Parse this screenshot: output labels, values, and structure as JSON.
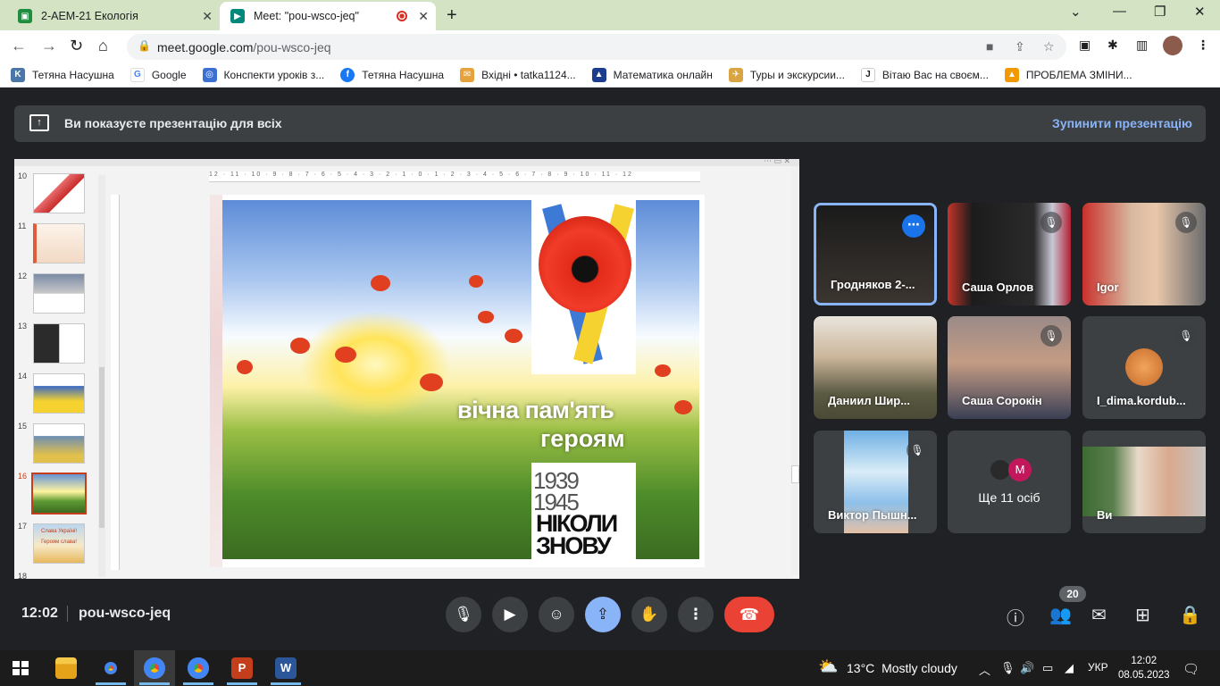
{
  "browser": {
    "tabs": [
      {
        "title": "2-АЕМ-21 Екологія",
        "favicon": "classroom-icon"
      },
      {
        "title": "Meet: \"pou-wsco-jeq\"",
        "favicon": "meet-icon",
        "recording": true
      }
    ],
    "url_host": "meet.google.com",
    "url_path": "/pou-wsco-jeq",
    "bookmarks": [
      {
        "label": "Тетяна Насушна",
        "icon": "vk-icon",
        "color": "#4a76a8"
      },
      {
        "label": "Google",
        "icon": "google-icon",
        "color": "#4285f4"
      },
      {
        "label": "Конспекти уроків з...",
        "icon": "globe-icon",
        "color": "#3b6fd1"
      },
      {
        "label": "Тетяна Насушна",
        "icon": "facebook-icon",
        "color": "#1877f2"
      },
      {
        "label": "Вхідні • tatka1124...",
        "icon": "mail-icon",
        "color": "#e6a23c"
      },
      {
        "label": "Математика онлайн",
        "icon": "triangle-icon",
        "color": "#1a3d8f"
      },
      {
        "label": "Туры и экскурсии...",
        "icon": "tour-icon",
        "color": "#d9a441"
      },
      {
        "label": "Вітаю Вас на своєм...",
        "icon": "j-icon",
        "color": "#222222"
      },
      {
        "label": "ПРОБЛЕМА ЗМІНИ...",
        "icon": "flame-icon",
        "color": "#f29900"
      }
    ]
  },
  "meet": {
    "banner_text": "Ви показуєте презентацію для всіх",
    "stop_label": "Зупинити презентацію",
    "time": "12:02",
    "meeting_code": "pou-wsco-jeq",
    "participant_count": "20",
    "participants": [
      {
        "name": "Гродняков 2-...",
        "muted": false
      },
      {
        "name": "Саша Орлов",
        "muted": true
      },
      {
        "name": "Igor",
        "muted": true
      },
      {
        "name": "Даниил Шир...",
        "muted": false
      },
      {
        "name": "Саша Сорокін",
        "muted": true
      },
      {
        "name": "I_dima.kordub...",
        "muted": true
      },
      {
        "name": "Виктор Пышн...",
        "muted": true
      },
      {
        "name": "Ще 11 осіб",
        "muted": false
      },
      {
        "name": "Ви",
        "muted": false
      }
    ],
    "more_avatar_letter": "M"
  },
  "presentation": {
    "ruler_text": "12 · 11 · 10 · 9 · 8 · 7 · 6 · 5 · 4 · 3 · 2 · 1 · 0 · 1 · 2 · 3 · 4 · 5 · 6 · 7 · 8 · 9 · 10 · 11 · 12",
    "slide_numbers": [
      "10",
      "11",
      "12",
      "13",
      "14",
      "15",
      "16",
      "17",
      "18"
    ],
    "selected_slide": "16",
    "caption_line1": "вічна пам'ять",
    "caption_line2": "героям",
    "year1": "1939",
    "year2": "1945",
    "never_line1": "НІКОЛИ",
    "never_line2": "ЗНОВУ",
    "thumb17_text1": "Слава Україні!",
    "thumb17_text2": "Героям слава!"
  },
  "taskbar": {
    "temperature": "13°C",
    "weather": "Mostly cloudy",
    "language": "УКР",
    "time": "12:02",
    "date": "08.05.2023"
  }
}
